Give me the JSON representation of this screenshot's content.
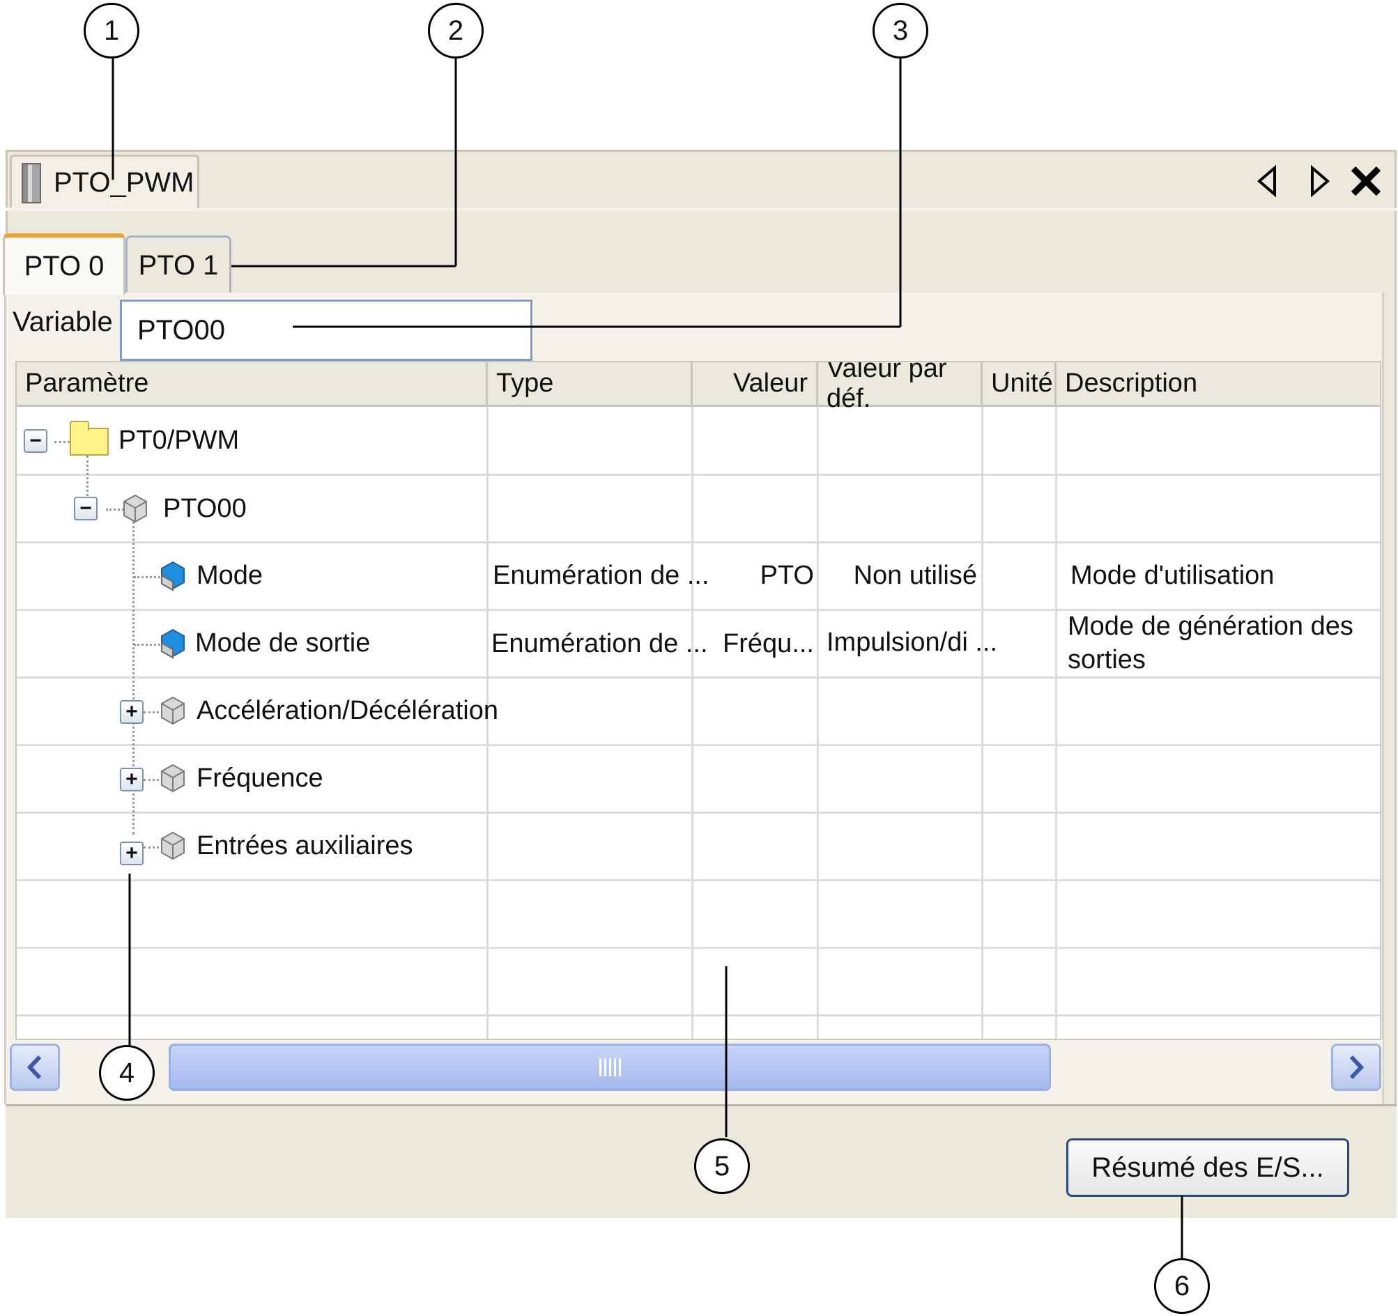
{
  "callouts": [
    "1",
    "2",
    "3",
    "4",
    "5",
    "6"
  ],
  "document_tab": {
    "title": "PTO_PWM",
    "icon": "plc-device-icon"
  },
  "window_controls": {
    "prev_icon": "triangle-left-icon",
    "next_icon": "triangle-right-icon",
    "close_icon": "close-icon"
  },
  "tabs": [
    {
      "label": "PTO 0",
      "active": true
    },
    {
      "label": "PTO 1",
      "active": false
    }
  ],
  "variable": {
    "label": "Variable :",
    "value": "PTO00"
  },
  "table": {
    "columns": [
      "Paramètre",
      "Type",
      "Valeur",
      "Valeur par déf.",
      "Unité",
      "Description"
    ],
    "rows": [
      {
        "name": "PT0/PWM",
        "icon": "folder-icon",
        "expander": "−",
        "type": "",
        "value": "",
        "default": "",
        "unit": "",
        "description": ""
      },
      {
        "name": "PTO00",
        "icon": "cube-icon",
        "expander": "−",
        "type": "",
        "value": "",
        "default": "",
        "unit": "",
        "description": ""
      },
      {
        "name": "Mode",
        "icon": "parameter-icon",
        "type": "Enumération de ...",
        "value": "PTO",
        "default": "Non utilisé",
        "unit": "",
        "description": "Mode d'utilisation"
      },
      {
        "name": "Mode de sortie",
        "icon": "parameter-icon",
        "type": "Enumération de ...",
        "value": "Fréqu...",
        "default": "Impulsion/di ...",
        "unit": "",
        "description": "Mode de génération des sorties"
      },
      {
        "name": "Accélération/Décélération",
        "icon": "cube-icon",
        "expander": "+",
        "type": "",
        "value": "",
        "default": "",
        "unit": "",
        "description": ""
      },
      {
        "name": "Fréquence",
        "icon": "cube-icon",
        "expander": "+",
        "type": "",
        "value": "",
        "default": "",
        "unit": "",
        "description": ""
      },
      {
        "name": "Entrées auxiliaires",
        "icon": "cube-icon",
        "expander": "+",
        "type": "",
        "value": "",
        "default": "",
        "unit": "",
        "description": ""
      }
    ]
  },
  "scrollbar": {
    "left_icon": "chevron-left-icon",
    "right_icon": "chevron-right-icon"
  },
  "summary_button": {
    "label": "Résumé des E/S..."
  },
  "colors": {
    "window_bg": "#ece9dc",
    "active_tab_accent": "#f0a030",
    "input_border": "#7f9cc8",
    "scroll_thumb": "#a6b9ef",
    "button_border": "#2a4a7a"
  }
}
